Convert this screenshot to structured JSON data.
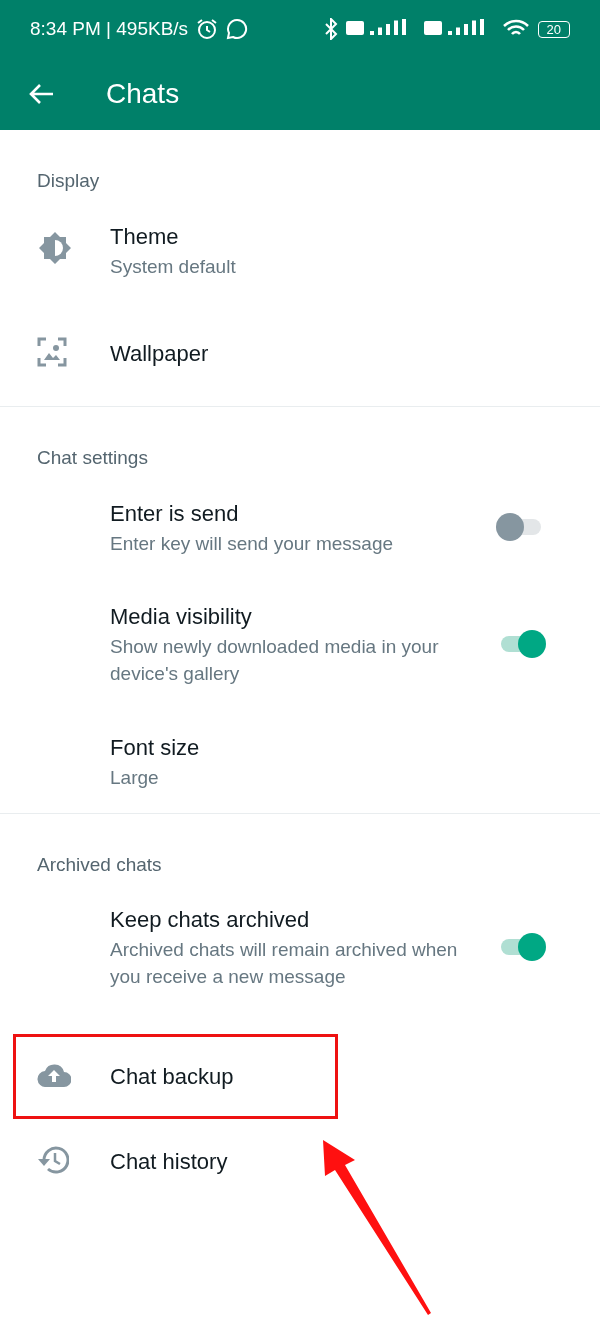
{
  "status_bar": {
    "time": "8:34 PM | 495KB/s",
    "battery": "20"
  },
  "toolbar": {
    "title": "Chats"
  },
  "sections": [
    {
      "title": "Display",
      "items": [
        {
          "kind": "link",
          "title": "Theme",
          "subtitle": "System default"
        },
        {
          "kind": "link",
          "title": "Wallpaper"
        }
      ]
    },
    {
      "title": "Chat settings",
      "items": [
        {
          "kind": "toggle",
          "title": "Enter is send",
          "subtitle": "Enter key will send your message",
          "on": false
        },
        {
          "kind": "toggle",
          "title": "Media visibility",
          "subtitle": "Show newly downloaded media in your device's gallery",
          "on": true
        },
        {
          "kind": "link",
          "title": "Font size",
          "subtitle": "Large"
        }
      ]
    },
    {
      "title": "Archived chats",
      "items": [
        {
          "kind": "toggle",
          "title": "Keep chats archived",
          "subtitle": "Archived chats will remain archived when you receive a new message",
          "on": true
        }
      ]
    },
    {
      "items": [
        {
          "kind": "link",
          "title": "Chat backup",
          "highlighted": true
        },
        {
          "kind": "link",
          "title": "Chat history",
          "highlighted": false
        }
      ]
    }
  ]
}
